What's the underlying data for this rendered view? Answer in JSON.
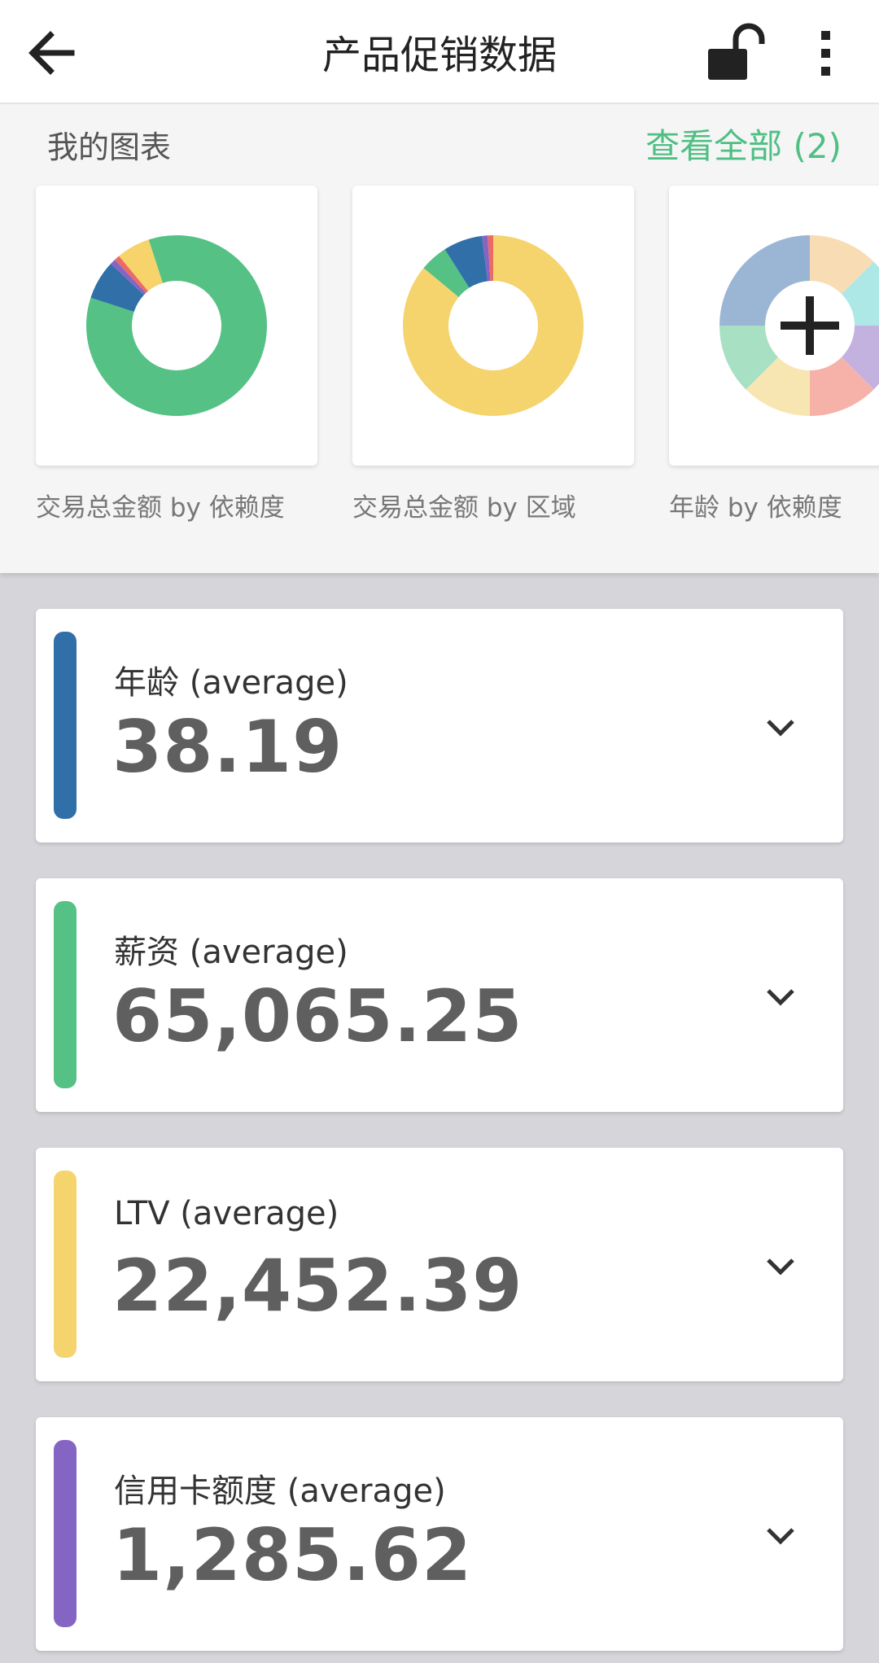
{
  "header": {
    "title": "产品促销数据",
    "back_icon": "arrow-left-icon",
    "lock_icon": "unlock-icon",
    "menu_icon": "more-vertical-icon"
  },
  "charts": {
    "section_label": "我的图表",
    "view_all_label": "查看全部 (2)",
    "cards": [
      {
        "caption": "交易总金额 by 依赖度",
        "slices": [
          {
            "value": 0.8,
            "color": "#55c185"
          },
          {
            "value": 0.07,
            "color": "#306fa7"
          },
          {
            "value": 0.01,
            "color": "#8565c4"
          },
          {
            "value": 0.01,
            "color": "#ea6b66"
          },
          {
            "value": 0.06,
            "color": "#f7d36c"
          },
          {
            "value": 0.05,
            "color": "#55c185"
          }
        ]
      },
      {
        "caption": "交易总金额 by 区域",
        "slices": [
          {
            "value": 0.86,
            "color": "#f5d46e"
          },
          {
            "value": 0.05,
            "color": "#55c185"
          },
          {
            "value": 0.07,
            "color": "#306fa7"
          },
          {
            "value": 0.01,
            "color": "#8565c4"
          },
          {
            "value": 0.01,
            "color": "#ea6b66"
          }
        ]
      },
      {
        "caption": "年龄 by 依赖度",
        "add_icon": "plus-icon",
        "slices": [
          {
            "value": 0.125,
            "color": "#f8dcb4"
          },
          {
            "value": 0.125,
            "color": "#aee8e6"
          },
          {
            "value": 0.125,
            "color": "#c3b2e0"
          },
          {
            "value": 0.125,
            "color": "#f6b2a8"
          },
          {
            "value": 0.125,
            "color": "#f8e6b2"
          },
          {
            "value": 0.125,
            "color": "#a8e0c4"
          },
          {
            "value": 0.25,
            "color": "#9ab6d4"
          }
        ]
      }
    ]
  },
  "metrics": [
    {
      "label": "年龄 (average)",
      "value": "38.19",
      "color": "#306fa7"
    },
    {
      "label": "薪资 (average)",
      "value": "65,065.25",
      "color": "#55c185"
    },
    {
      "label": "LTV (average)",
      "value": "22,452.39",
      "color": "#f5d46e"
    },
    {
      "label": "信用卡额度 (average)",
      "value": "1,285.62",
      "color": "#8565c4"
    }
  ]
}
